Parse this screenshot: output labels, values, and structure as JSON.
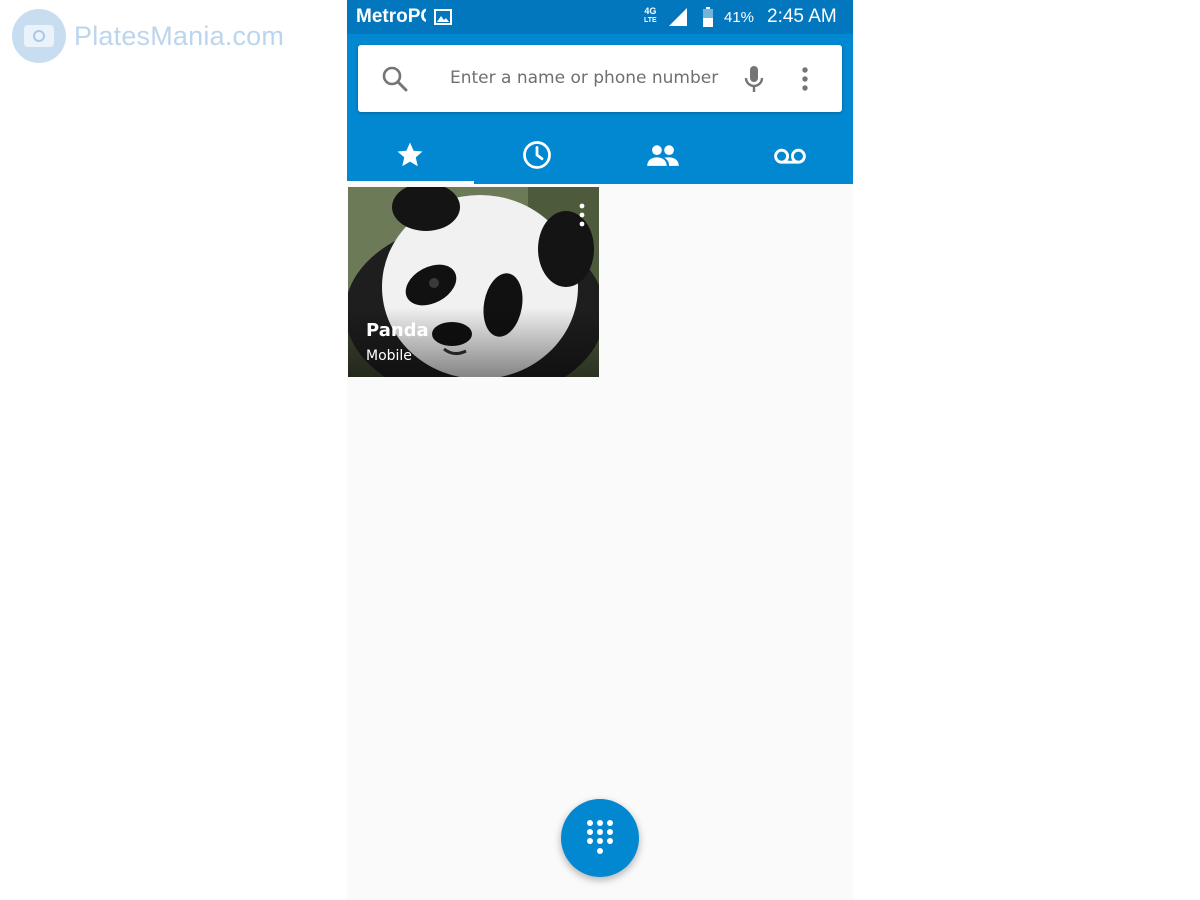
{
  "watermark": {
    "text": "PlatesMania.com"
  },
  "status_bar": {
    "carrier": "MetroPCS",
    "network_top": "4G",
    "network_bottom": "LTE",
    "battery": "41%",
    "time": "2:45 AM",
    "icons": [
      "gallery-icon",
      "lte-icon",
      "signal-icon",
      "battery-icon"
    ]
  },
  "search": {
    "placeholder": "Enter a name or phone number",
    "value": "",
    "icons": [
      "search-icon",
      "mic-icon",
      "more-vert-icon"
    ]
  },
  "tabs": [
    {
      "icon": "star-icon",
      "name": "favorites",
      "active": true
    },
    {
      "icon": "clock-icon",
      "name": "recents",
      "active": false
    },
    {
      "icon": "people-icon",
      "name": "contacts",
      "active": false
    },
    {
      "icon": "voicemail-icon",
      "name": "voicemail",
      "active": false
    }
  ],
  "favorites": [
    {
      "name": "Panda",
      "label": "Mobile",
      "photo": "panda-photo"
    }
  ],
  "fab": {
    "icon": "dialpad-icon"
  },
  "colors": {
    "primary": "#0288d1",
    "status_bar": "#0277bd",
    "background": "#fafafa",
    "tab_indicator": "#ffffff"
  }
}
